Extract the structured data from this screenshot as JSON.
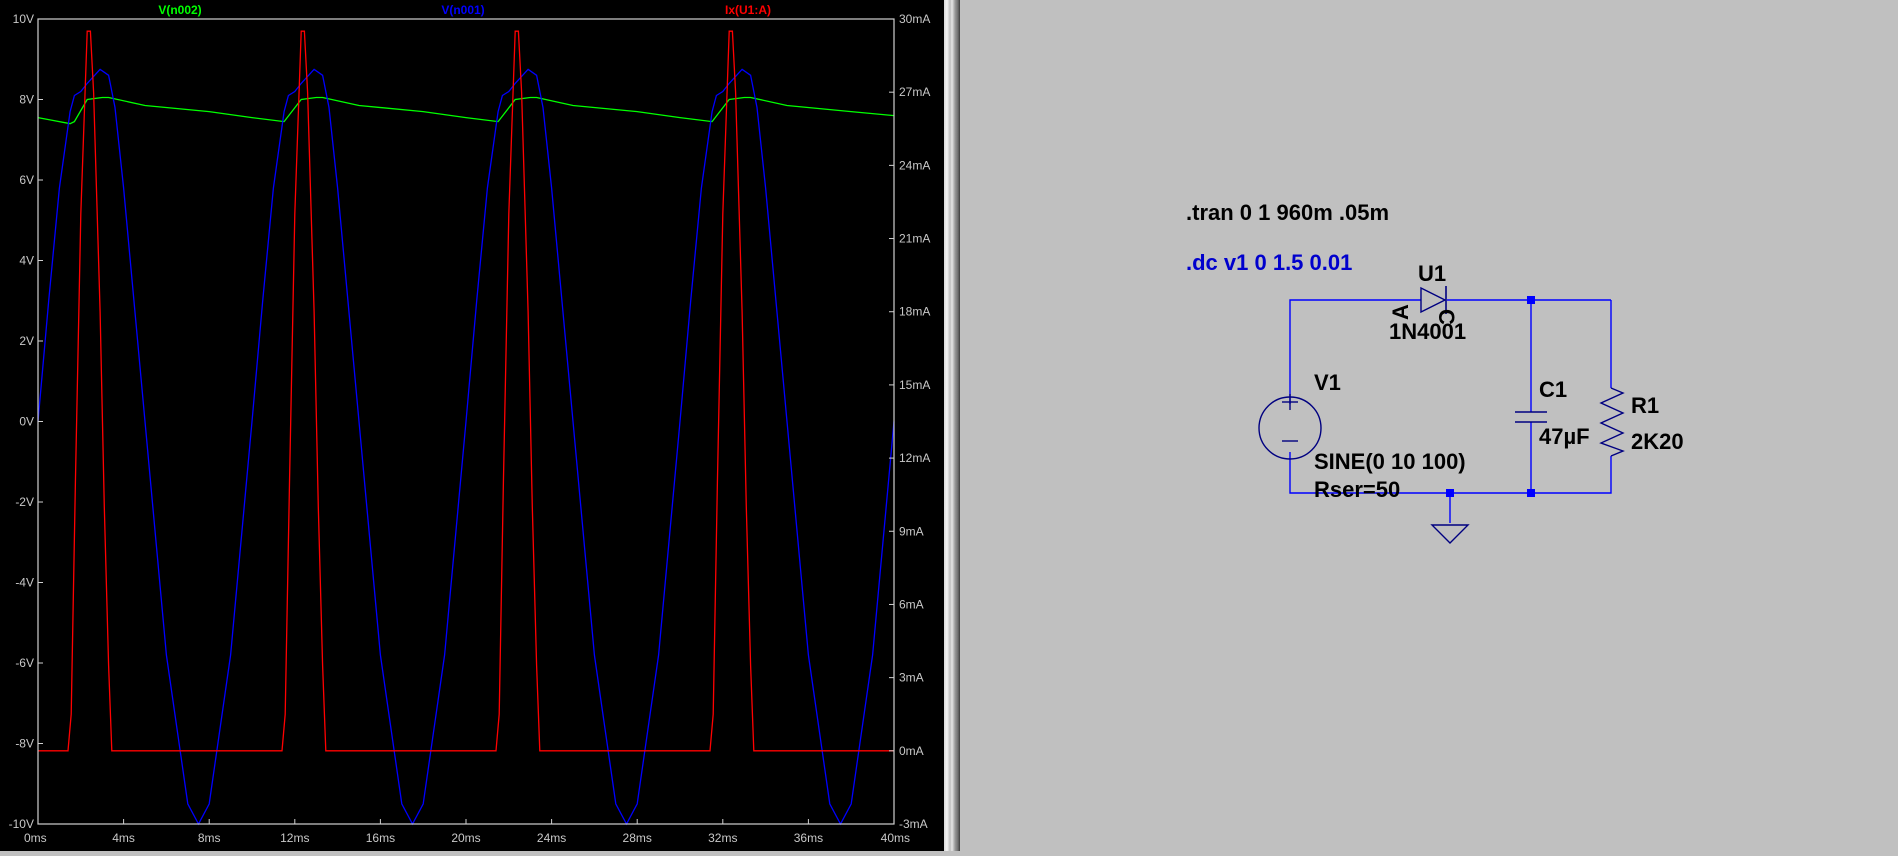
{
  "plot": {
    "traces": [
      {
        "name": "V(n002)",
        "color": "#00ff00"
      },
      {
        "name": "V(n001)",
        "color": "#0000ff"
      },
      {
        "name": "Ix(U1:A)",
        "color": "#ff0000"
      }
    ],
    "y_left_ticks": [
      "10V",
      "8V",
      "6V",
      "4V",
      "2V",
      "0V",
      "-2V",
      "-4V",
      "-6V",
      "-8V",
      "-10V"
    ],
    "y_right_ticks": [
      "30mA",
      "27mA",
      "24mA",
      "21mA",
      "18mA",
      "15mA",
      "12mA",
      "9mA",
      "6mA",
      "3mA",
      "0mA",
      "-3mA"
    ],
    "x_ticks": [
      "0ms",
      "4ms",
      "8ms",
      "12ms",
      "16ms",
      "20ms",
      "24ms",
      "28ms",
      "32ms",
      "36ms",
      "40ms"
    ]
  },
  "chart_data": {
    "type": "line",
    "title": "",
    "xlabel": "",
    "x_unit": "ms",
    "xlim": [
      0,
      40
    ],
    "ylim_left": [
      -10,
      10
    ],
    "ylim_right": [
      -3,
      30
    ],
    "grid": false,
    "legend": "top",
    "signal_frequency_hz": 100,
    "series": [
      {
        "name": "V(n002)",
        "axis": "left",
        "unit": "V",
        "color": "#00ff00",
        "points": [
          [
            0,
            7.55
          ],
          [
            0.5,
            7.5
          ],
          [
            1.5,
            7.4
          ],
          [
            1.7,
            7.45
          ],
          [
            2.3,
            8.0
          ],
          [
            3.0,
            8.05
          ],
          [
            3.3,
            8.05
          ],
          [
            5,
            7.85
          ],
          [
            8,
            7.7
          ],
          [
            10,
            7.55
          ],
          [
            11.5,
            7.45
          ],
          [
            12.3,
            8.0
          ],
          [
            13.0,
            8.05
          ],
          [
            13.3,
            8.05
          ],
          [
            15,
            7.85
          ],
          [
            18,
            7.7
          ],
          [
            20,
            7.55
          ],
          [
            21.5,
            7.45
          ],
          [
            22.3,
            8.0
          ],
          [
            23.0,
            8.05
          ],
          [
            23.3,
            8.05
          ],
          [
            25,
            7.85
          ],
          [
            28,
            7.7
          ],
          [
            30,
            7.55
          ],
          [
            31.5,
            7.45
          ],
          [
            32.3,
            8.0
          ],
          [
            33.0,
            8.05
          ],
          [
            33.3,
            8.05
          ],
          [
            35,
            7.85
          ],
          [
            38,
            7.7
          ],
          [
            40,
            7.6
          ]
        ]
      },
      {
        "name": "V(n001)",
        "axis": "left",
        "unit": "V",
        "color": "#0000ff",
        "points": [
          [
            0,
            0
          ],
          [
            0.5,
            3.0
          ],
          [
            1,
            5.8
          ],
          [
            1.5,
            7.7
          ],
          [
            1.7,
            8.1
          ],
          [
            2.0,
            8.2
          ],
          [
            2.3,
            8.4
          ],
          [
            2.9,
            8.75
          ],
          [
            3.3,
            8.6
          ],
          [
            3.6,
            7.8
          ],
          [
            4,
            5.8
          ],
          [
            5,
            0
          ],
          [
            6,
            -5.8
          ],
          [
            7,
            -9.5
          ],
          [
            7.5,
            -10
          ],
          [
            8,
            -9.5
          ],
          [
            9,
            -5.8
          ],
          [
            10,
            0
          ],
          [
            10.5,
            3.0
          ],
          [
            11,
            5.8
          ],
          [
            11.5,
            7.7
          ],
          [
            11.7,
            8.1
          ],
          [
            12.0,
            8.2
          ],
          [
            12.3,
            8.4
          ],
          [
            12.9,
            8.75
          ],
          [
            13.3,
            8.6
          ],
          [
            13.6,
            7.8
          ],
          [
            14,
            5.8
          ],
          [
            15,
            0
          ],
          [
            16,
            -5.8
          ],
          [
            17,
            -9.5
          ],
          [
            17.5,
            -10
          ],
          [
            18,
            -9.5
          ],
          [
            19,
            -5.8
          ],
          [
            20,
            0
          ],
          [
            20.5,
            3.0
          ],
          [
            21,
            5.8
          ],
          [
            21.5,
            7.7
          ],
          [
            21.7,
            8.1
          ],
          [
            22.0,
            8.2
          ],
          [
            22.3,
            8.4
          ],
          [
            22.9,
            8.75
          ],
          [
            23.3,
            8.6
          ],
          [
            23.6,
            7.8
          ],
          [
            24,
            5.8
          ],
          [
            25,
            0
          ],
          [
            26,
            -5.8
          ],
          [
            27,
            -9.5
          ],
          [
            27.5,
            -10
          ],
          [
            28,
            -9.5
          ],
          [
            29,
            -5.8
          ],
          [
            30,
            0
          ],
          [
            30.5,
            3.0
          ],
          [
            31,
            5.8
          ],
          [
            31.5,
            7.7
          ],
          [
            31.7,
            8.1
          ],
          [
            32.0,
            8.2
          ],
          [
            32.3,
            8.4
          ],
          [
            32.9,
            8.75
          ],
          [
            33.3,
            8.6
          ],
          [
            33.6,
            7.8
          ],
          [
            34,
            5.8
          ],
          [
            35,
            0
          ],
          [
            36,
            -5.8
          ],
          [
            37,
            -9.5
          ],
          [
            37.5,
            -10
          ],
          [
            38,
            -9.5
          ],
          [
            39,
            -5.8
          ],
          [
            40,
            0
          ]
        ]
      },
      {
        "name": "Ix(U1:A)",
        "axis": "right",
        "unit": "mA",
        "color": "#ff0000",
        "points": [
          [
            0,
            0
          ],
          [
            1.4,
            0
          ],
          [
            1.55,
            1.5
          ],
          [
            1.75,
            11
          ],
          [
            2.0,
            22
          ],
          [
            2.3,
            29.5
          ],
          [
            2.45,
            29.5
          ],
          [
            2.6,
            27
          ],
          [
            2.9,
            18
          ],
          [
            3.1,
            10
          ],
          [
            3.3,
            3.5
          ],
          [
            3.45,
            0
          ],
          [
            11.4,
            0
          ],
          [
            11.55,
            1.5
          ],
          [
            11.75,
            11
          ],
          [
            12.0,
            22
          ],
          [
            12.3,
            29.5
          ],
          [
            12.45,
            29.5
          ],
          [
            12.6,
            27
          ],
          [
            12.9,
            18
          ],
          [
            13.1,
            10
          ],
          [
            13.3,
            3.5
          ],
          [
            13.45,
            0
          ],
          [
            21.4,
            0
          ],
          [
            21.55,
            1.5
          ],
          [
            21.75,
            11
          ],
          [
            22.0,
            22
          ],
          [
            22.3,
            29.5
          ],
          [
            22.45,
            29.5
          ],
          [
            22.6,
            27
          ],
          [
            22.9,
            18
          ],
          [
            23.1,
            10
          ],
          [
            23.3,
            3.5
          ],
          [
            23.45,
            0
          ],
          [
            31.4,
            0
          ],
          [
            31.55,
            1.5
          ],
          [
            31.75,
            11
          ],
          [
            32.0,
            22
          ],
          [
            32.3,
            29.5
          ],
          [
            32.45,
            29.5
          ],
          [
            32.6,
            27
          ],
          [
            32.9,
            18
          ],
          [
            33.1,
            10
          ],
          [
            33.3,
            3.5
          ],
          [
            33.45,
            0
          ],
          [
            40,
            0
          ]
        ]
      }
    ]
  },
  "schematic": {
    "directive_tran": ".tran 0 1 960m .05m",
    "directive_dc": ".dc v1 0 1.5 0.01",
    "diode_ref": "U1",
    "diode_model": "1N4001",
    "diode_pin_a": "A",
    "diode_pin_c": "C",
    "source_ref": "V1",
    "source_value": "SINE(0 10 100)",
    "source_rser": "Rser=50",
    "cap_ref": "C1",
    "cap_value": "47µF",
    "res_ref": "R1",
    "res_value": "2K20",
    "wire_color": "#0000ff",
    "dc_directive_color": "#0000cd"
  }
}
